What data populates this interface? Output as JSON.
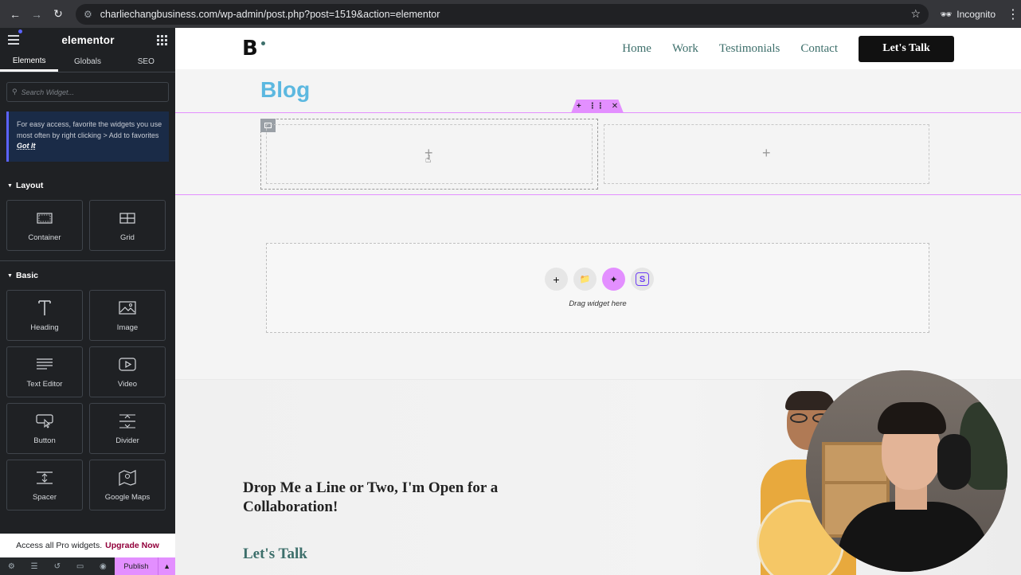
{
  "browser": {
    "url": "charliechangbusiness.com/wp-admin/post.php?post=1519&action=elementor",
    "incognito_label": "Incognito"
  },
  "panel": {
    "logo": "elementor",
    "tabs": [
      {
        "label": "Elements",
        "active": true
      },
      {
        "label": "Globals",
        "active": false
      },
      {
        "label": "SEO",
        "active": false
      }
    ],
    "search_placeholder": "Search Widget...",
    "tip": {
      "text": "For easy access, favorite the widgets you use most often by right clicking > Add to favorites",
      "link": "Got It"
    },
    "sections": {
      "layout": {
        "title": "Layout",
        "widgets": [
          {
            "label": "Container",
            "icon": "container-icon"
          },
          {
            "label": "Grid",
            "icon": "grid-icon"
          }
        ]
      },
      "basic": {
        "title": "Basic",
        "widgets": [
          {
            "label": "Heading",
            "icon": "heading-icon"
          },
          {
            "label": "Image",
            "icon": "image-icon"
          },
          {
            "label": "Text Editor",
            "icon": "text-editor-icon"
          },
          {
            "label": "Video",
            "icon": "video-icon"
          },
          {
            "label": "Button",
            "icon": "button-icon"
          },
          {
            "label": "Divider",
            "icon": "divider-icon"
          },
          {
            "label": "Spacer",
            "icon": "spacer-icon"
          },
          {
            "label": "Google Maps",
            "icon": "google-maps-icon"
          }
        ]
      }
    },
    "promo": {
      "text": "Access all Pro widgets.",
      "link": "Upgrade Now"
    },
    "footer": {
      "publish_label": "Publish"
    }
  },
  "site": {
    "brand": "B",
    "nav": [
      "Home",
      "Work",
      "Testimonials",
      "Contact"
    ],
    "cta": "Let's Talk",
    "blog_title": "Blog",
    "dropzone_text": "Drag widget here",
    "contact_heading": "Drop Me a Line or Two, I'm Open for a Collaboration!",
    "contact_sub": "Let's Talk"
  },
  "colors": {
    "panel_bg": "#1f2124",
    "accent_pink": "#e38fff",
    "blog_blue": "#5cb8e0",
    "nav_green": "#3d6f6b",
    "promo_link": "#92003b"
  }
}
